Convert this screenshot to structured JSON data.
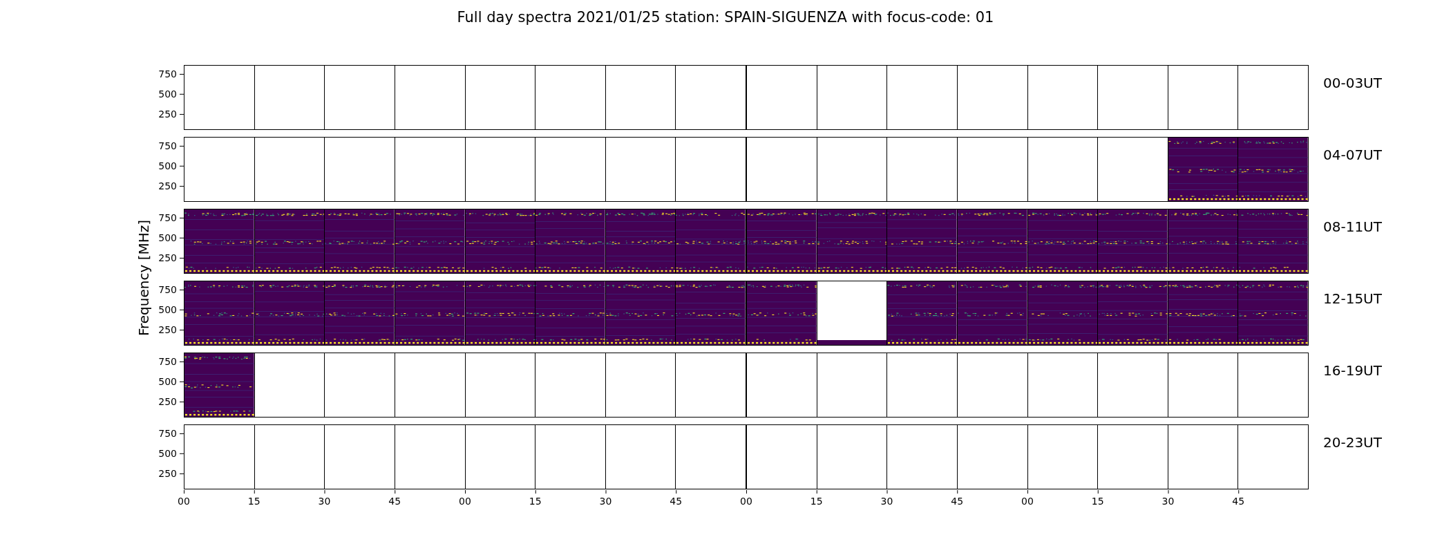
{
  "title": "Full day spectra 2021/01/25 station: SPAIN-SIGUENZA with focus-code: 01",
  "ylabel": "Frequency [MHz]",
  "rows": [
    {
      "label": "00-03UT",
      "yticks": [
        "750",
        "500",
        "250"
      ],
      "cells": [
        {
          "kind": "blank"
        },
        {
          "kind": "blank"
        },
        {
          "kind": "blank"
        },
        {
          "kind": "blank"
        },
        {
          "kind": "blank"
        },
        {
          "kind": "blank"
        },
        {
          "kind": "blank"
        },
        {
          "kind": "blank"
        },
        {
          "kind": "blank"
        },
        {
          "kind": "blank"
        },
        {
          "kind": "blank"
        },
        {
          "kind": "blank"
        },
        {
          "kind": "blank"
        },
        {
          "kind": "blank"
        },
        {
          "kind": "blank"
        },
        {
          "kind": "blank"
        }
      ]
    },
    {
      "label": "04-07UT",
      "yticks": [
        "750",
        "500",
        "250"
      ],
      "cells": [
        {
          "kind": "blank"
        },
        {
          "kind": "blank"
        },
        {
          "kind": "blank"
        },
        {
          "kind": "blank"
        },
        {
          "kind": "blank"
        },
        {
          "kind": "blank"
        },
        {
          "kind": "blank"
        },
        {
          "kind": "blank"
        },
        {
          "kind": "blank"
        },
        {
          "kind": "blank"
        },
        {
          "kind": "blank"
        },
        {
          "kind": "blank"
        },
        {
          "kind": "blank"
        },
        {
          "kind": "blank"
        },
        {
          "kind": "spectrum"
        },
        {
          "kind": "spectrum"
        }
      ]
    },
    {
      "label": "08-11UT",
      "yticks": [
        "750",
        "500",
        "250"
      ],
      "cells": [
        {
          "kind": "spectrum"
        },
        {
          "kind": "spectrum"
        },
        {
          "kind": "spectrum"
        },
        {
          "kind": "spectrum"
        },
        {
          "kind": "spectrum"
        },
        {
          "kind": "spectrum"
        },
        {
          "kind": "spectrum"
        },
        {
          "kind": "spectrum"
        },
        {
          "kind": "spectrum"
        },
        {
          "kind": "spectrum"
        },
        {
          "kind": "spectrum"
        },
        {
          "kind": "spectrum"
        },
        {
          "kind": "spectrum"
        },
        {
          "kind": "spectrum"
        },
        {
          "kind": "spectrum"
        },
        {
          "kind": "spectrum"
        }
      ]
    },
    {
      "label": "12-15UT",
      "yticks": [
        "750",
        "500",
        "250"
      ],
      "cells": [
        {
          "kind": "spectrum"
        },
        {
          "kind": "spectrum"
        },
        {
          "kind": "spectrum"
        },
        {
          "kind": "spectrum"
        },
        {
          "kind": "spectrum"
        },
        {
          "kind": "spectrum"
        },
        {
          "kind": "spectrum"
        },
        {
          "kind": "spectrum"
        },
        {
          "kind": "spectrum"
        },
        {
          "kind": "gap"
        },
        {
          "kind": "spectrum"
        },
        {
          "kind": "spectrum"
        },
        {
          "kind": "spectrum"
        },
        {
          "kind": "spectrum"
        },
        {
          "kind": "spectrum"
        },
        {
          "kind": "spectrum"
        }
      ]
    },
    {
      "label": "16-19UT",
      "yticks": [
        "750",
        "500",
        "250"
      ],
      "cells": [
        {
          "kind": "spectrum"
        },
        {
          "kind": "blank"
        },
        {
          "kind": "blank"
        },
        {
          "kind": "blank"
        },
        {
          "kind": "blank"
        },
        {
          "kind": "blank"
        },
        {
          "kind": "blank"
        },
        {
          "kind": "blank"
        },
        {
          "kind": "blank"
        },
        {
          "kind": "blank"
        },
        {
          "kind": "blank"
        },
        {
          "kind": "blank"
        },
        {
          "kind": "blank"
        },
        {
          "kind": "blank"
        },
        {
          "kind": "blank"
        },
        {
          "kind": "blank"
        }
      ]
    },
    {
      "label": "20-23UT",
      "yticks": [
        "750",
        "500",
        "250"
      ],
      "cells": [
        {
          "kind": "blank"
        },
        {
          "kind": "blank"
        },
        {
          "kind": "blank"
        },
        {
          "kind": "blank"
        },
        {
          "kind": "blank"
        },
        {
          "kind": "blank"
        },
        {
          "kind": "blank"
        },
        {
          "kind": "blank"
        },
        {
          "kind": "blank"
        },
        {
          "kind": "blank"
        },
        {
          "kind": "blank"
        },
        {
          "kind": "blank"
        },
        {
          "kind": "blank"
        },
        {
          "kind": "blank"
        },
        {
          "kind": "blank"
        },
        {
          "kind": "blank"
        }
      ]
    }
  ],
  "xticks": [
    "00",
    "15",
    "30",
    "45",
    "00",
    "15",
    "30",
    "45",
    "00",
    "15",
    "30",
    "45",
    "00",
    "15",
    "30",
    "45"
  ]
}
